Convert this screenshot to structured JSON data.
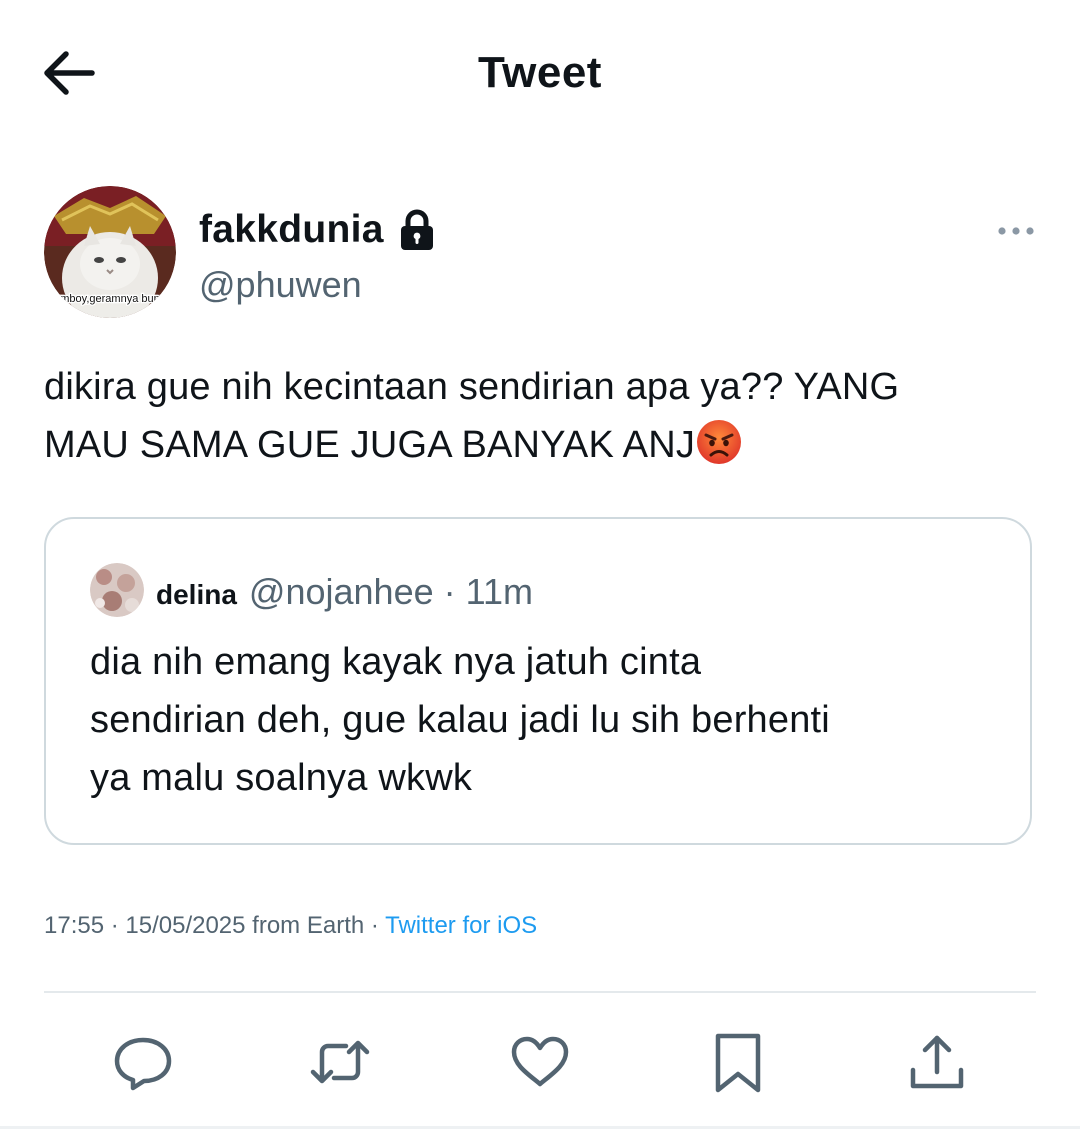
{
  "header": {
    "title": "Tweet",
    "back_icon": "arrow-left-icon"
  },
  "author": {
    "display_name": "fakkdunia",
    "handle": "@phuwen",
    "avatar_caption": "mboy,geramnya bun",
    "protected_icon": "lock-icon",
    "more_icon": "more-horizontal-icon"
  },
  "tweet": {
    "line1": "dikira gue nih kecintaan sendirian apa ya?? YANG",
    "line2": "MAU SAMA GUE JUGA BANYAK ANJ",
    "emoji": "angry-face-emoji"
  },
  "quote": {
    "name": "delina",
    "handle_time": "@nojanhee · 11m",
    "line1": "dia nih emang kayak nya jatuh cinta",
    "line2": "sendirian deh, gue kalau jadi lu sih berhenti",
    "line3": "ya malu soalnya wkwk"
  },
  "meta": {
    "time_date": "17:55 · 15/05/2025 from Earth · ",
    "source": "Twitter for iOS"
  },
  "actions": {
    "reply_icon": "reply-icon",
    "retweet_icon": "retweet-icon",
    "like_icon": "heart-icon",
    "bookmark_icon": "bookmark-icon",
    "share_icon": "share-icon"
  },
  "colors": {
    "text": "#0f1419",
    "secondary": "#536471",
    "link": "#1d9bf0",
    "border": "#cfd9de"
  }
}
